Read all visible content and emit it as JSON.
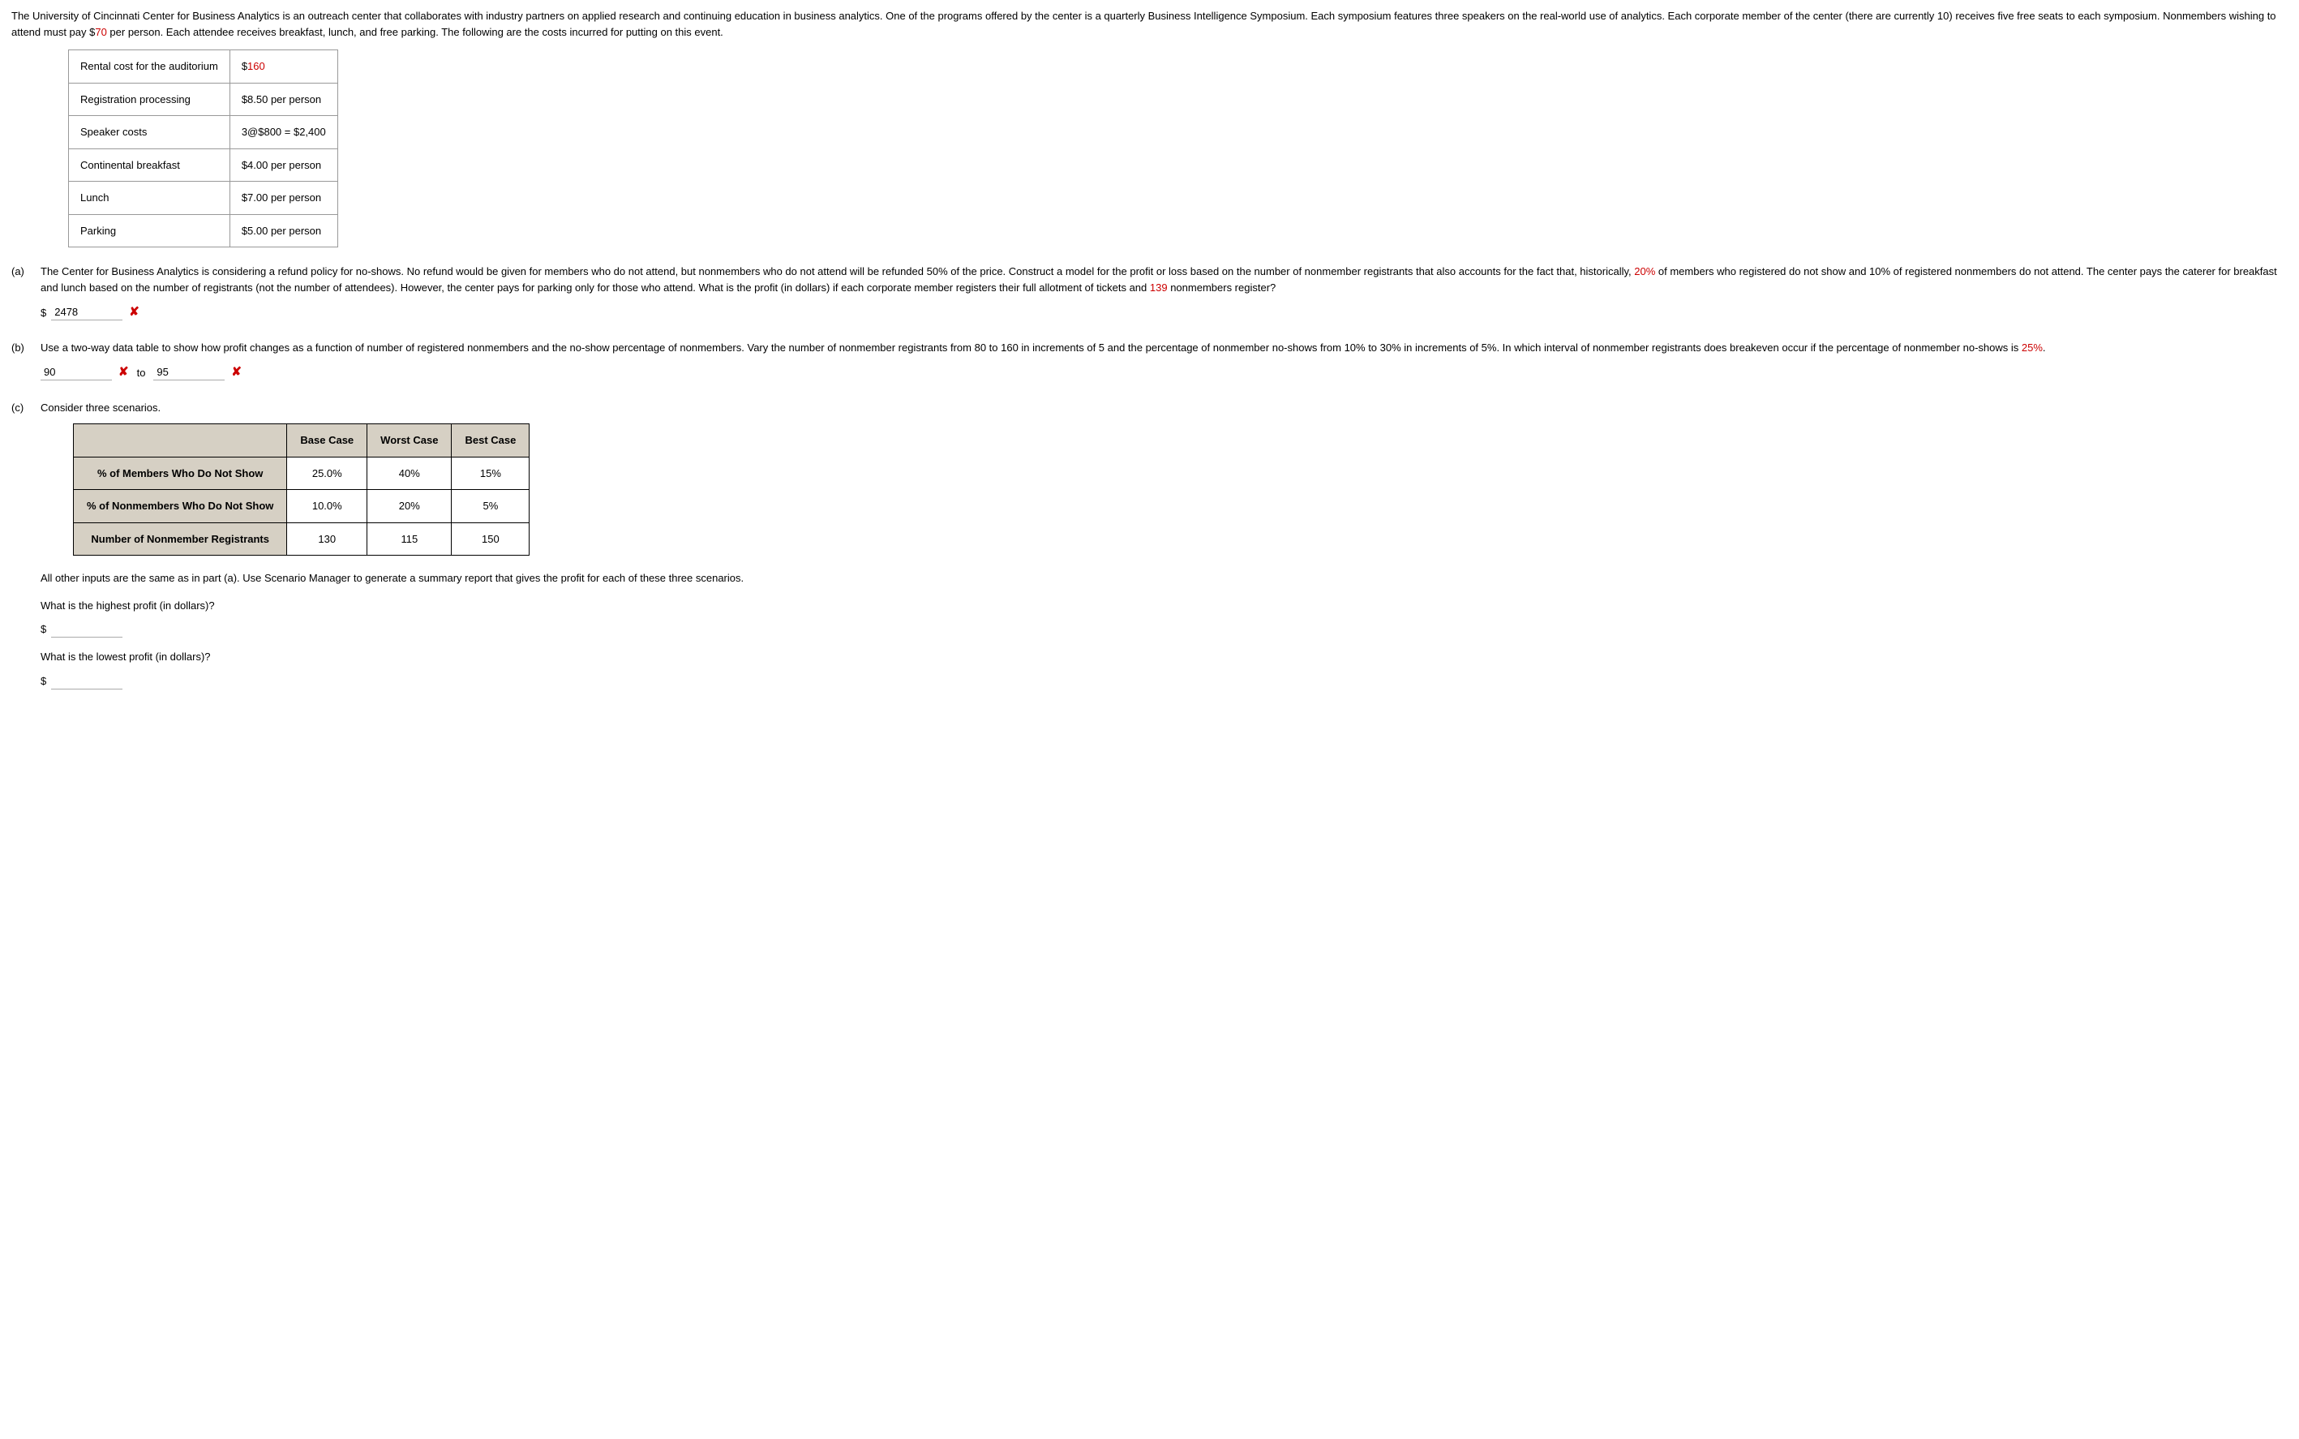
{
  "intro": {
    "text_a": "The University of Cincinnati Center for Business Analytics is an outreach center that collaborates with industry partners on applied research and continuing education in business analytics. One of the programs offered by the center is a quarterly Business Intelligence Symposium. Each symposium features three speakers on the real-world use of analytics. Each corporate member of the center (there are currently 10) receives five free seats to each symposium. Nonmembers wishing to attend must pay $",
    "fee": "70",
    "text_b": " per person. Each attendee receives breakfast, lunch, and free parking. The following are the costs incurred for putting on this event."
  },
  "costs": {
    "rows": [
      {
        "label": "Rental cost for the auditorium",
        "value_prefix": "$",
        "value_red": "160",
        "value_suffix": ""
      },
      {
        "label": "Registration processing",
        "value_prefix": "$8.50 per person",
        "value_red": "",
        "value_suffix": ""
      },
      {
        "label": "Speaker costs",
        "value_prefix": "3@$800 = $2,400",
        "value_red": "",
        "value_suffix": ""
      },
      {
        "label": "Continental breakfast",
        "value_prefix": "$4.00 per person",
        "value_red": "",
        "value_suffix": ""
      },
      {
        "label": "Lunch",
        "value_prefix": "$7.00 per person",
        "value_red": "",
        "value_suffix": ""
      },
      {
        "label": "Parking",
        "value_prefix": "$5.00 per person",
        "value_red": "",
        "value_suffix": ""
      }
    ]
  },
  "partA": {
    "label": "(a)",
    "t1": "The Center for Business Analytics is considering a refund policy for no-shows. No refund would be given for members who do not attend, but nonmembers who do not attend will be refunded 50% of the price. Construct a model for the profit or loss based on the number of nonmember registrants that also accounts for the fact that, historically, ",
    "pct_members": "20%",
    "t2": " of members who registered do not show and 10% of registered nonmembers do not attend. The center pays the caterer for breakfast and lunch based on the number of registrants (not the number of attendees). However, the center pays for parking only for those who attend. What is the profit (in dollars) if each corporate member registers their full allotment of tickets and ",
    "nonmember_count": "139",
    "t3": " nonmembers register?",
    "dollar": "$",
    "answer": "2478"
  },
  "partB": {
    "label": "(b)",
    "t1": "Use a two-way data table to show how profit changes as a function of number of registered nonmembers and the no-show percentage of nonmembers. Vary the number of nonmember registrants from 80 to 160 in increments of 5 and the percentage of nonmember no-shows from 10% to 30% in increments of 5%. In which interval of nonmember registrants does breakeven occur if the percentage of nonmember no-shows is ",
    "pct": "25%",
    "t2": ".",
    "ans1": "90",
    "to": "to",
    "ans2": "95"
  },
  "partC": {
    "label": "(c)",
    "intro": "Consider three scenarios.",
    "headers": [
      "Base Case",
      "Worst Case",
      "Best Case"
    ],
    "rows": [
      {
        "h": "% of Members Who Do Not Show",
        "c": [
          "25.0%",
          "40%",
          "15%"
        ]
      },
      {
        "h": "% of Nonmembers Who Do Not Show",
        "c": [
          "10.0%",
          "20%",
          "5%"
        ]
      },
      {
        "h": "Number of Nonmember Registrants",
        "c": [
          "130",
          "115",
          "150"
        ]
      }
    ],
    "after": "All other inputs are the same as in part (a). Use Scenario Manager to generate a summary report that gives the profit for each of these three scenarios.",
    "q1": "What is the highest profit (in dollars)?",
    "q2": "What is the lowest profit (in dollars)?",
    "dollar": "$"
  }
}
